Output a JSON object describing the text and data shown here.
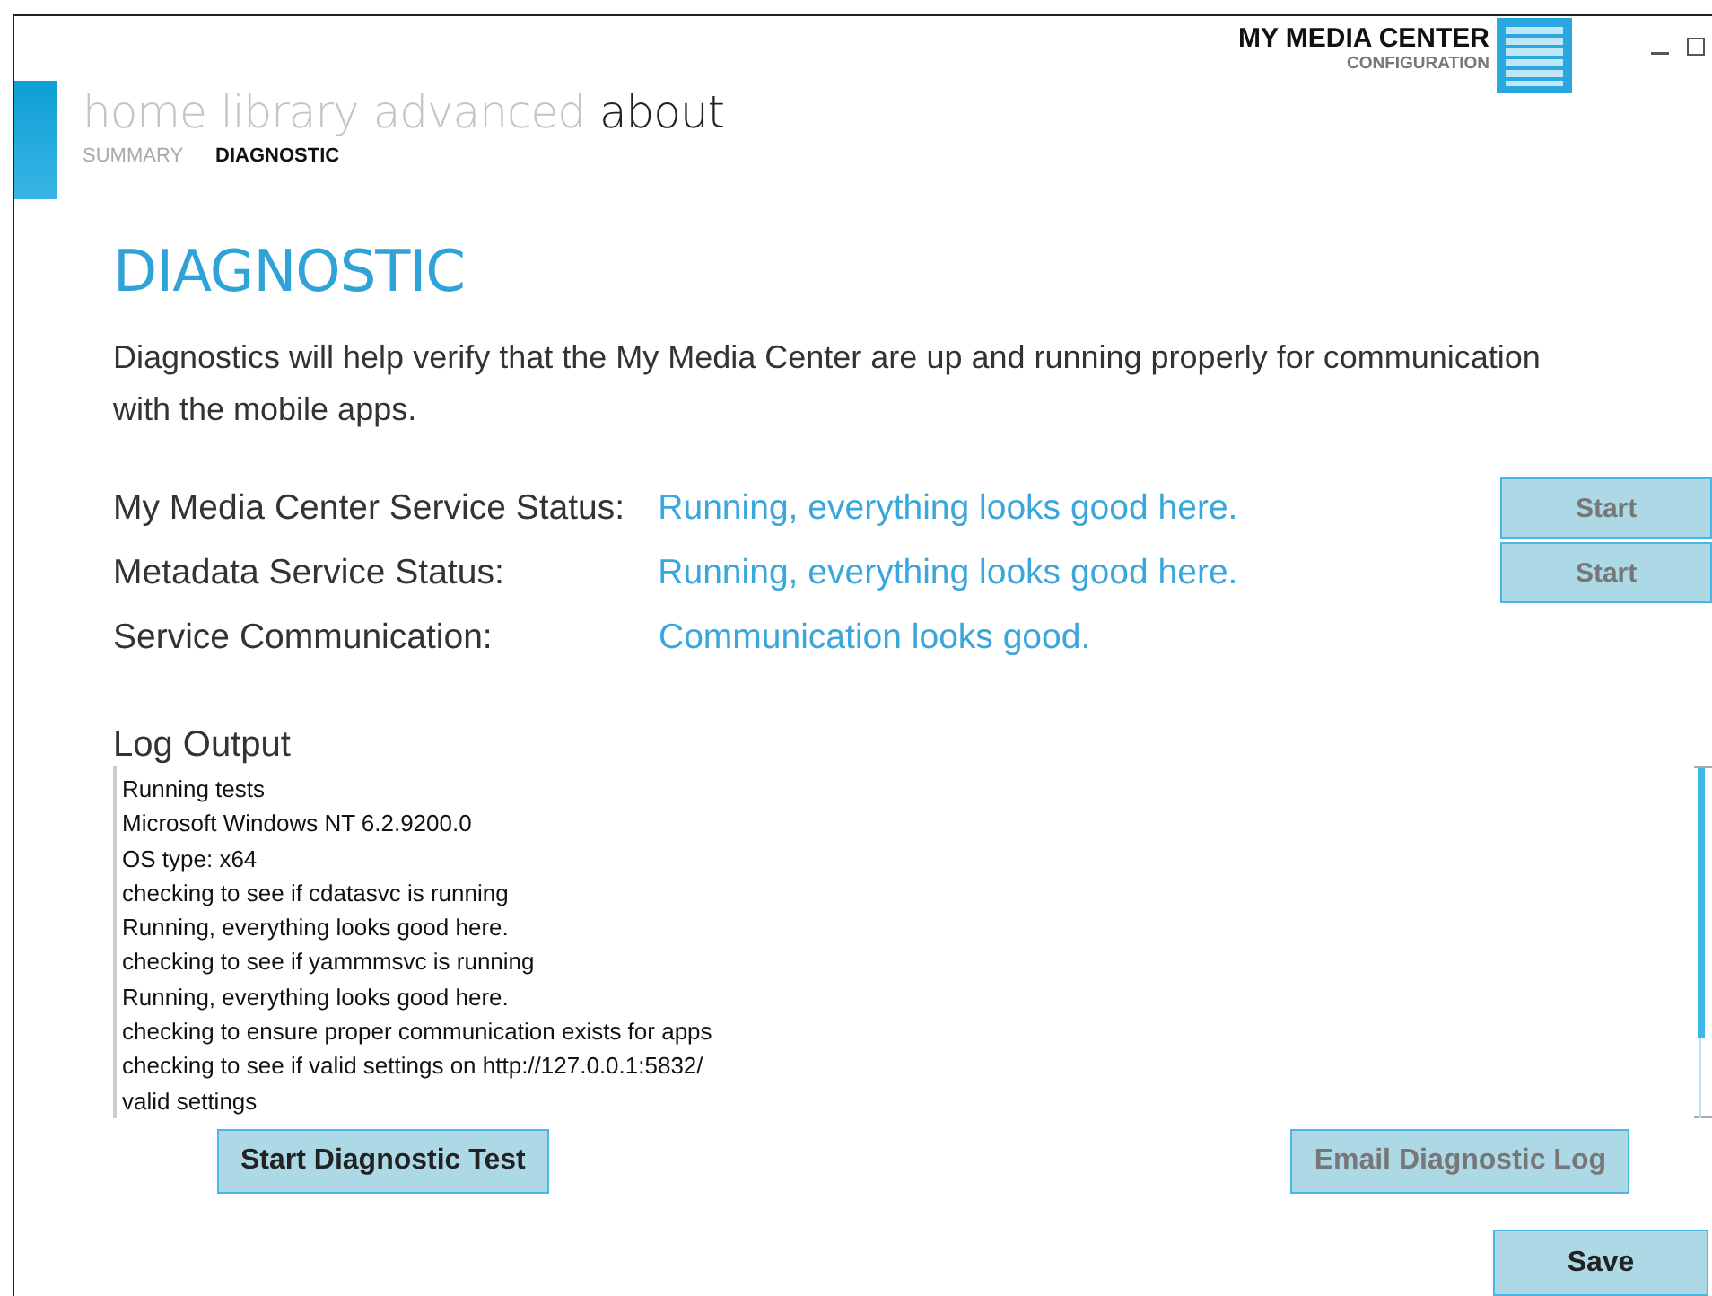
{
  "app": {
    "title": "MY MEDIA CENTER",
    "subtitle": "CONFIGURATION"
  },
  "tabs": [
    {
      "label": "home",
      "selected": false
    },
    {
      "label": "library",
      "selected": false
    },
    {
      "label": "advanced",
      "selected": false
    },
    {
      "label": "about",
      "selected": true
    }
  ],
  "subtabs": [
    {
      "label": "SUMMARY",
      "selected": false
    },
    {
      "label": "DIAGNOSTIC",
      "selected": true
    }
  ],
  "page": {
    "title": "DIAGNOSTIC",
    "description": "Diagnostics will help verify that the My Media Center are up and running properly for communication with the mobile apps."
  },
  "statuses": [
    {
      "label": "My Media Center Service Status:",
      "value": "Running, everything looks good here.",
      "button": {
        "label": "Start",
        "disabled": true
      }
    },
    {
      "label": "Metadata Service Status:",
      "value": "Running, everything looks good here.",
      "button": {
        "label": "Start",
        "disabled": true
      }
    },
    {
      "label": "Service Communication:",
      "value": "Communication looks good."
    }
  ],
  "log": {
    "label": "Log Output",
    "lines": [
      "Running tests",
      "Microsoft Windows NT 6.2.9200.0",
      "OS type: x64",
      "checking to see if cdatasvc is running",
      "Running, everything looks good here.",
      "checking to see if yammmsvc is running",
      "Running, everything looks good here.",
      "checking to ensure proper communication exists for apps",
      "checking to see if valid settings on http://127.0.0.1:5832/",
      "valid settings"
    ]
  },
  "buttons": [
    {
      "label": "Start Diagnostic Test",
      "disabled": false
    },
    {
      "label": "Email Diagnostic Log",
      "disabled": true
    }
  ],
  "save": {
    "label": "Save",
    "disabled": false
  }
}
